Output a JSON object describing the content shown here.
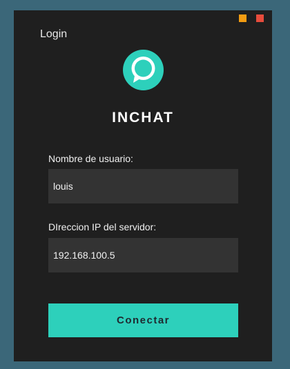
{
  "window": {
    "title": "Login",
    "controls": {
      "minimize_color": "#f39c12",
      "close_color": "#e74c3c"
    }
  },
  "app": {
    "name": "INCHAT",
    "logo_icon": "chat-bubble-icon",
    "accent_color": "#2dd0bb"
  },
  "form": {
    "username": {
      "label": "Nombre de usuario:",
      "value": "louis"
    },
    "server_ip": {
      "label": "DIreccion IP del servidor:",
      "value": "192.168.100.5"
    },
    "connect_label": "Conectar"
  }
}
